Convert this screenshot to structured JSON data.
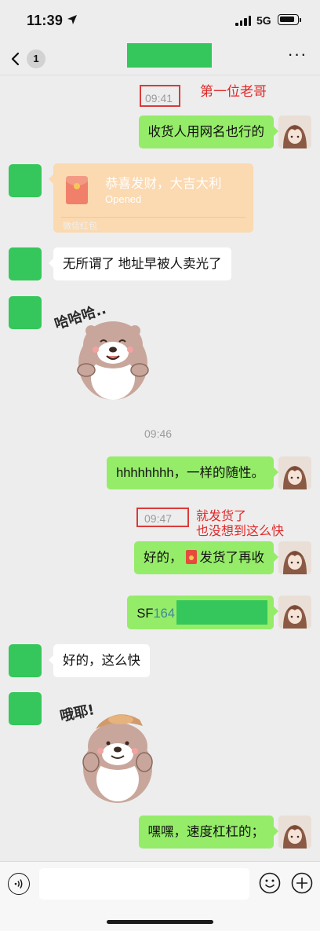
{
  "status_bar": {
    "time": "11:39",
    "network": "5G"
  },
  "nav": {
    "back_badge": "1",
    "more": "···"
  },
  "messages": {
    "t1": "09:41",
    "annot1": "第一位老哥",
    "m1": "收货人用网名也行的",
    "redpacket": {
      "title": "恭喜发财，大吉大利",
      "status": "Opened",
      "footer": "微信红包"
    },
    "m2": "无所谓了 地址早被人卖光了",
    "sticker1_text": "哈哈哈..",
    "t2": "09:46",
    "m3": "hhhhhhhh，一样的随性。",
    "t3": "09:47",
    "annot2_line1": "就发货了",
    "annot2_line2": "也没想到这么快",
    "m4_prefix": "好的，",
    "m4_suffix": "发货了再收",
    "m5_prefix": "SF",
    "m5_digits": "164",
    "m6": "好的，这么快",
    "sticker2_text": "哦耶!",
    "m7": "嘿嘿，速度杠杠的；"
  },
  "input": {
    "placeholder": ""
  },
  "colors": {
    "background": "#ededed",
    "bubble_out": "#95ec69",
    "bubble_in": "#ffffff",
    "redpacket": "#fbd9b1",
    "annotation": "#e02828",
    "redacted": "#35c75b"
  },
  "icons": [
    "location-arrow-icon",
    "signal-icon",
    "battery-icon",
    "chevron-left-icon",
    "more-icon",
    "red-packet-icon",
    "voice-icon",
    "emoji-icon",
    "plus-icon"
  ]
}
